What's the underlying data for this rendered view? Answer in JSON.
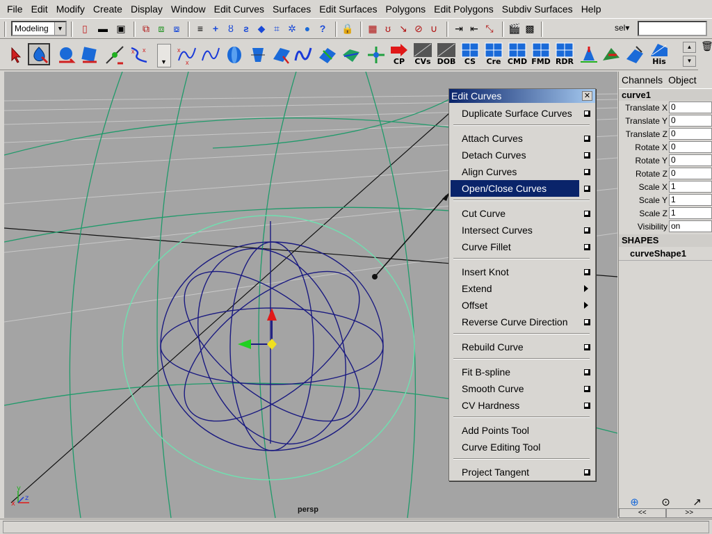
{
  "menubar": {
    "items": [
      "File",
      "Edit",
      "Modify",
      "Create",
      "Display",
      "Window",
      "Edit Curves",
      "Surfaces",
      "Edit Surfaces",
      "Polygons",
      "Edit Polygons",
      "Subdiv Surfaces",
      "Help"
    ]
  },
  "statusline": {
    "mode": "Modeling",
    "selection_label": "sel▾",
    "input_value": ""
  },
  "shelf": {
    "labels": [
      "CP",
      "CVs",
      "DOB",
      "CS",
      "Cre",
      "CMD",
      "FMD",
      "RDR",
      "His"
    ],
    "accent": "#1a6ad8"
  },
  "viewport": {
    "camera": "persp",
    "axis_labels": {
      "x": "x",
      "y": "y",
      "z": "z"
    }
  },
  "channel_box": {
    "tabs": [
      "Channels",
      "Object"
    ],
    "node_name": "curve1",
    "attributes": [
      {
        "name": "Translate X",
        "value": "0"
      },
      {
        "name": "Translate Y",
        "value": "0"
      },
      {
        "name": "Translate Z",
        "value": "0"
      },
      {
        "name": "Rotate X",
        "value": "0"
      },
      {
        "name": "Rotate Y",
        "value": "0"
      },
      {
        "name": "Rotate Z",
        "value": "0"
      },
      {
        "name": "Scale X",
        "value": "1"
      },
      {
        "name": "Scale Y",
        "value": "1"
      },
      {
        "name": "Scale Z",
        "value": "1"
      },
      {
        "name": "Visibility",
        "value": "on"
      }
    ],
    "shapes_header": "SHAPES",
    "shape_name": "curveShape1",
    "nav": [
      "<<",
      ">>"
    ]
  },
  "edit_curves_menu": {
    "title": "Edit Curves",
    "close_label": "✕",
    "items": [
      {
        "label": "Duplicate Surface Curves",
        "option": true
      },
      {
        "label": "Attach Curves",
        "option": true
      },
      {
        "label": "Detach Curves",
        "option": true
      },
      {
        "label": "Align Curves",
        "option": true
      },
      {
        "label": "Open/Close Curves",
        "option": true,
        "highlighted": true
      },
      {
        "label": "Cut Curve",
        "option": true
      },
      {
        "label": "Intersect Curves",
        "option": true
      },
      {
        "label": "Curve Fillet",
        "option": true
      },
      {
        "label": "Insert Knot",
        "option": true
      },
      {
        "label": "Extend",
        "submenu": true
      },
      {
        "label": "Offset",
        "submenu": true
      },
      {
        "label": "Reverse Curve Direction",
        "option": true
      },
      {
        "label": "Rebuild Curve",
        "option": true
      },
      {
        "label": "Fit B-spline",
        "option": true
      },
      {
        "label": "Smooth Curve",
        "option": true
      },
      {
        "label": "CV Hardness",
        "option": true
      },
      {
        "label": "Add Points Tool"
      },
      {
        "label": "Curve Editing Tool"
      },
      {
        "label": "Project Tangent",
        "option": true
      }
    ],
    "highlight_color": "#0a246a"
  },
  "colors": {
    "ui_gray": "#d8d6d2",
    "viewport_bg": "#a4a4a4",
    "curve_dark_blue": "#1a1a80",
    "curve_green": "#1f9a6a",
    "curve_light_green": "#6fe0b0",
    "manip_red": "#e01818",
    "manip_green": "#20d020",
    "manip_yellow": "#f0e020"
  }
}
